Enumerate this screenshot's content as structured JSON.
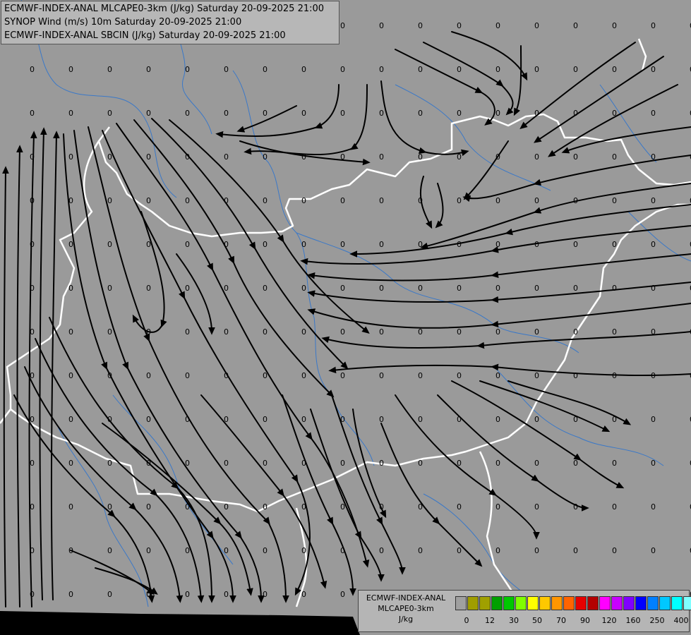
{
  "header": {
    "lines": [
      "ECMWF-INDEX-ANAL MLCAPE0-3km (J/kg) Saturday 20-09-2025 21:00",
      "SYNOP Wind (m/s) 10m Saturday 20-09-2025 21:00",
      "ECMWF-INDEX-ANAL SBCIN (J/kg) Saturday 20-09-2025 21:00"
    ]
  },
  "legend": {
    "model": "ECMWF-INDEX-ANAL",
    "param": "MLCAPE0-3km",
    "unit": "J/kg",
    "colors": [
      "#a0a0a0",
      "#a09d00",
      "#a0a000",
      "#00a000",
      "#00c800",
      "#80ff00",
      "#ffff00",
      "#ffc800",
      "#ff9600",
      "#ff6400",
      "#e60000",
      "#b40000",
      "#ff00ff",
      "#c800ff",
      "#8000ff",
      "#0000ff",
      "#0080ff",
      "#00c8ff",
      "#00ffff",
      "#80ffff",
      "#ffffff"
    ],
    "ticks": [
      "0",
      "12",
      "30",
      "50",
      "70",
      "90",
      "120",
      "160",
      "250",
      "400"
    ]
  },
  "map": {
    "value_label": "0",
    "colors": {
      "background": "#9a9a9a",
      "streamline": "#000000",
      "border": "#ffffff",
      "river": "#3a78c8"
    }
  }
}
